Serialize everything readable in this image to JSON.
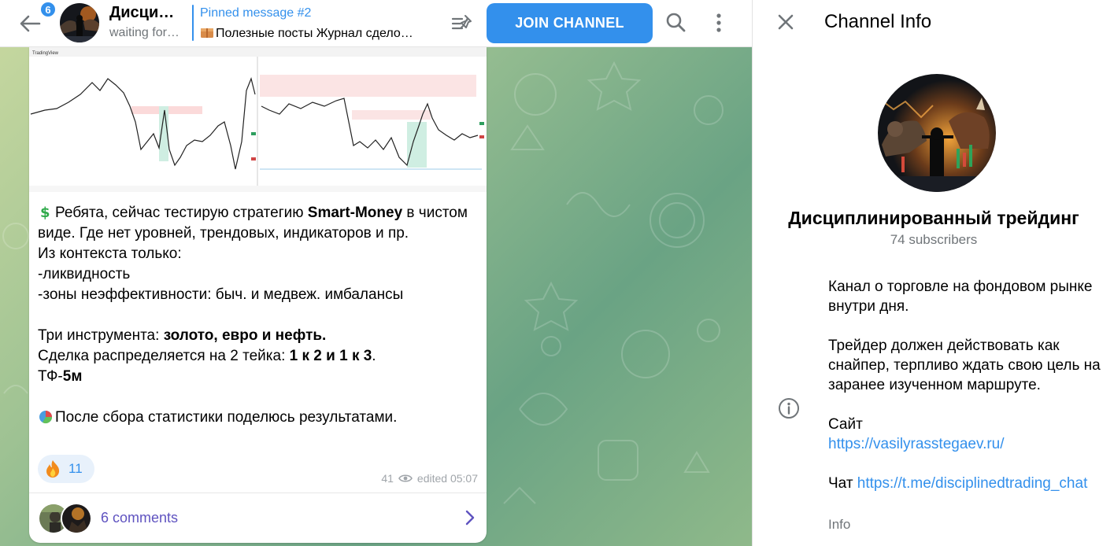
{
  "header": {
    "unread_count": "6",
    "chat_title": "Дисци…",
    "chat_status": "waiting for…",
    "pinned_label": "Pinned message #2",
    "pinned_text": "Полезные посты Журнал сдело…",
    "join_label": "JOIN CHANNEL",
    "icons": [
      "back-arrow-icon",
      "pinned-list-icon",
      "search-icon",
      "more-vertical-icon"
    ]
  },
  "message": {
    "line1_a": "Ребята, сейчас тестирую стратегию ",
    "line1_b": "Smart-Money",
    "line1_c": " в чистом виде. Где нет уровней, трендовых, индикаторов и пр.",
    "line2": "Из контекста только:",
    "line3": "-ликвидность",
    "line4": "-зоны неэффективности: быч. и медвеж. имбалансы",
    "line5_a": "Три инструмента: ",
    "line5_b": "золото, евро и нефть.",
    "line6_a": "Сделка распределяется на 2 тейка: ",
    "line6_b": "1 к 2 и 1 к 3",
    "line6_c": ".",
    "line7_a": "ТФ-",
    "line7_b": "5м",
    "line8": "После сбора статистики поделюсь результатами.",
    "reaction_count": "11",
    "views": "41",
    "edited": "edited 05:07",
    "comments_label": "6 comments"
  },
  "info": {
    "title": "Channel Info",
    "name": "Дисциплинированный трейдинг",
    "subscribers": "74 subscribers",
    "desc1": "Канал о торговле на фондовом рынке внутри дня.",
    "desc2": "Трейдер должен действовать как снайпер, терпливо ждать свою цель на заранее изученном маршруте.",
    "site_label": "Сайт",
    "site_url": "https://vasilyrasstegaev.ru/",
    "chat_label": "Чат ",
    "chat_url": "https://t.me/disciplinedtrading_chat",
    "caption": "Info"
  },
  "colors": {
    "accent": "#3390ec",
    "comments": "#5f53c0",
    "muted": "#707579"
  }
}
